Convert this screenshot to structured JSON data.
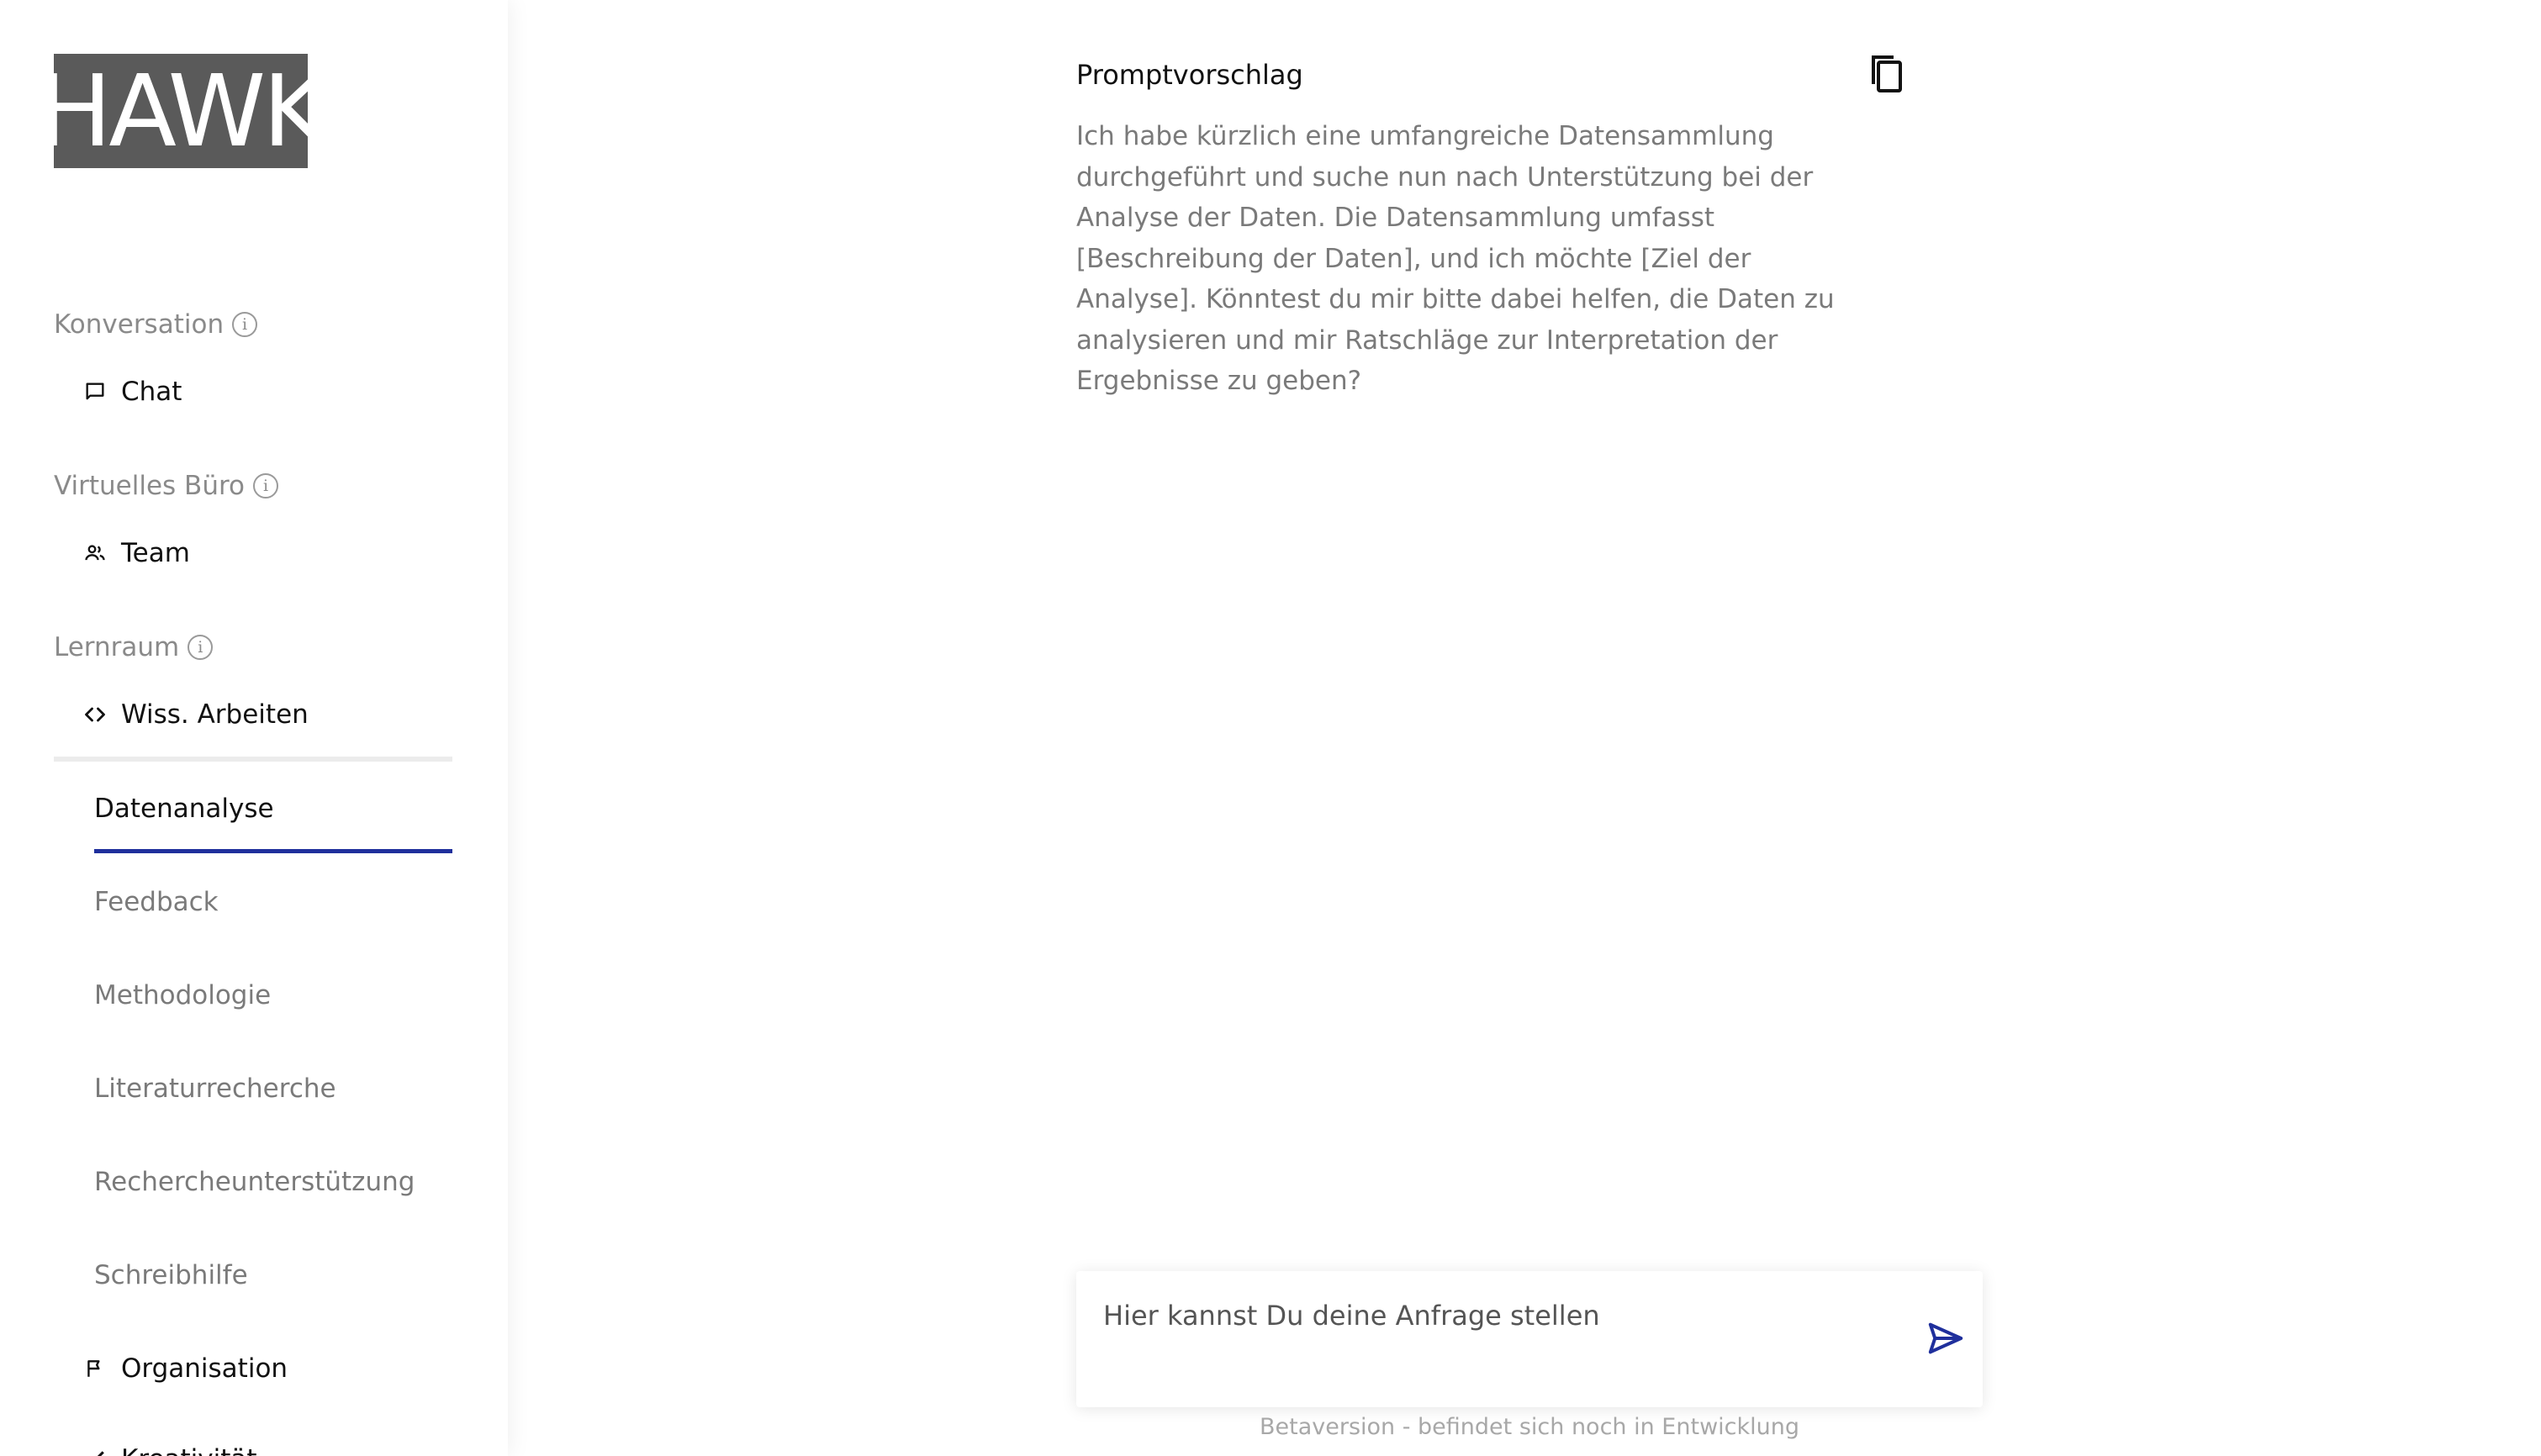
{
  "brand": {
    "logo_text": "HAWK"
  },
  "sidebar": {
    "sections": [
      {
        "label": "Konversation",
        "items": [
          {
            "label": "Chat",
            "icon": "chat-icon"
          }
        ]
      },
      {
        "label": "Virtuelles Büro",
        "items": [
          {
            "label": "Team",
            "icon": "team-icon"
          }
        ]
      },
      {
        "label": "Lernraum",
        "items": [
          {
            "label": "Wiss. Arbeiten",
            "icon": "code-icon"
          }
        ]
      }
    ],
    "sub_items": [
      {
        "label": "Datenanalyse",
        "active": true
      },
      {
        "label": "Feedback"
      },
      {
        "label": "Methodologie"
      },
      {
        "label": "Literaturrecherche"
      },
      {
        "label": "Rechercheunterstützung"
      },
      {
        "label": "Schreibhilfe"
      }
    ],
    "more_items": [
      {
        "label": "Organisation",
        "icon": "flag-icon"
      },
      {
        "label": "Kreativität",
        "icon": "brush-icon"
      }
    ],
    "info_glyph": "i"
  },
  "main": {
    "prompt_title": "Promptvorschlag",
    "prompt_text": "Ich habe kürzlich eine umfangreiche Datensammlung durchgeführt und suche nun nach Unterstützung bei der Analyse der Daten. Die Datensammlung umfasst [Beschreibung der Daten], und ich möchte [Ziel der Analyse]. Könntest du mir bitte dabei helfen, die Daten zu analysieren und mir Ratschläge zur Interpretation der Ergebnisse zu geben?",
    "input_placeholder": "Hier kannst Du deine Anfrage stellen",
    "footer_note": "Betaversion - befindet sich noch in Entwicklung"
  },
  "colors": {
    "accent": "#1f2f9c",
    "logo_bg": "#5a5a5a"
  }
}
